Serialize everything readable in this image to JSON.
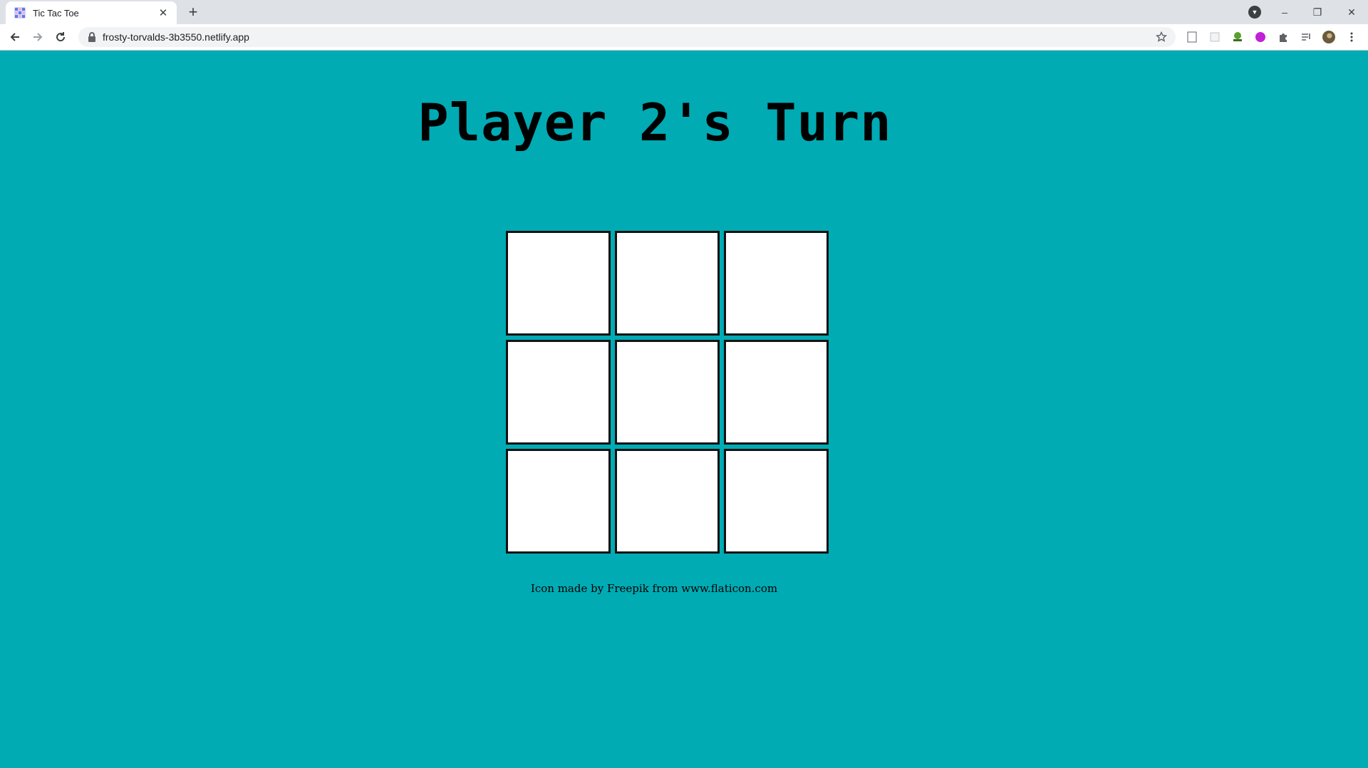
{
  "browser": {
    "tab_title": "Tic Tac Toe",
    "new_tab_label": "+",
    "tab_close_label": "✕",
    "url": "frosty-torvalds-3b3550.netlify.app",
    "window_controls": {
      "minimize": "–",
      "maximize": "❐",
      "close": "✕"
    }
  },
  "page": {
    "heading": "Player 2's Turn",
    "board": [
      "",
      "",
      "",
      "",
      "",
      "",
      "",
      "",
      ""
    ],
    "credit": "Icon made by Freepik from www.flaticon.com",
    "background_color": "#00abb4"
  }
}
